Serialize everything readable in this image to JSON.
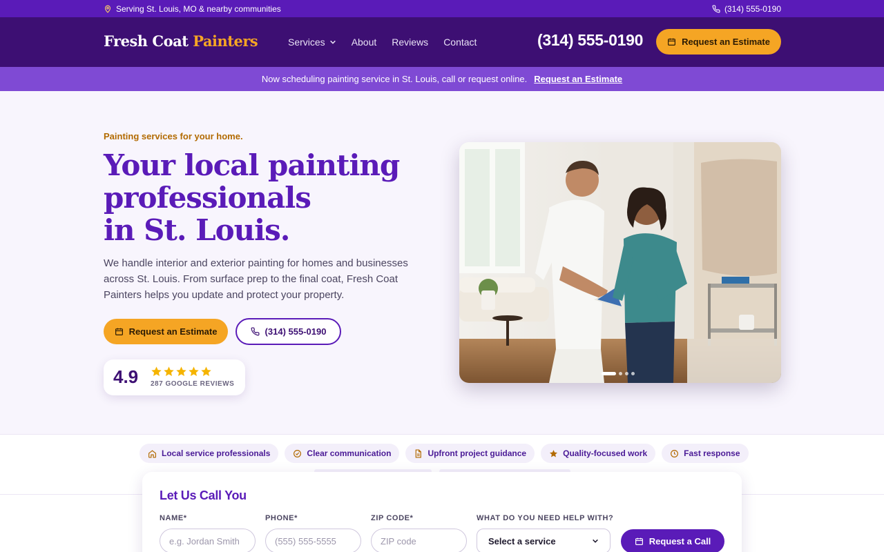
{
  "topbar": {
    "service_area": "Serving St. Louis, MO & nearby communities",
    "phone": "(314) 555-0190"
  },
  "header": {
    "logo_main": "Fresh Coat",
    "logo_accent": "Painters",
    "nav": {
      "services": "Services",
      "about": "About",
      "reviews": "Reviews",
      "contact": "Contact"
    },
    "phone": "(314) 555-0190",
    "cta": "Request an Estimate"
  },
  "announcement": {
    "text": "Now scheduling painting service in St. Louis, call or request online.",
    "link": "Request an Estimate"
  },
  "hero": {
    "eyebrow": "Painting services for your home.",
    "headline": [
      "Your local painting",
      "professionals",
      "in St. Louis."
    ],
    "lead": "We handle interior and exterior painting for homes and businesses across St. Louis. From surface prep to the final coat, Fresh Coat Painters helps you update and protect your property.",
    "primary_cta": "Request an Estimate",
    "phone_cta": "(314) 555-0190",
    "rating": {
      "score": "4.9",
      "stars": 5,
      "label": "287 GOOGLE REVIEWS"
    },
    "carousel": {
      "slides": 4,
      "active": 1
    }
  },
  "features": [
    {
      "label": "Local service professionals",
      "icon": "home-icon"
    },
    {
      "label": "Clear communication",
      "icon": "check-circle-icon"
    },
    {
      "label": "Upfront project guidance",
      "icon": "document-icon"
    },
    {
      "label": "Quality-focused work",
      "icon": "star-icon"
    },
    {
      "label": "Fast response",
      "icon": "clock-icon"
    }
  ],
  "call_form": {
    "title": "Let Us Call You",
    "name_label": "NAME*",
    "name_placeholder": "e.g. Jordan Smith",
    "phone_label": "PHONE*",
    "phone_placeholder": "(555) 555-5555",
    "zip_label": "ZIP CODE*",
    "zip_placeholder": "ZIP code",
    "service_label": "WHAT DO YOU NEED HELP WITH?",
    "service_selected": "Select a service",
    "submit": "Request a Call"
  },
  "colors": {
    "brand_purple": "#5a1bb8",
    "header_purple": "#3d0f73",
    "announce_purple": "#7f4ad4",
    "accent_orange": "#f5a524",
    "eyebrow_gold": "#b26a00",
    "star_gold": "#f5b400"
  }
}
